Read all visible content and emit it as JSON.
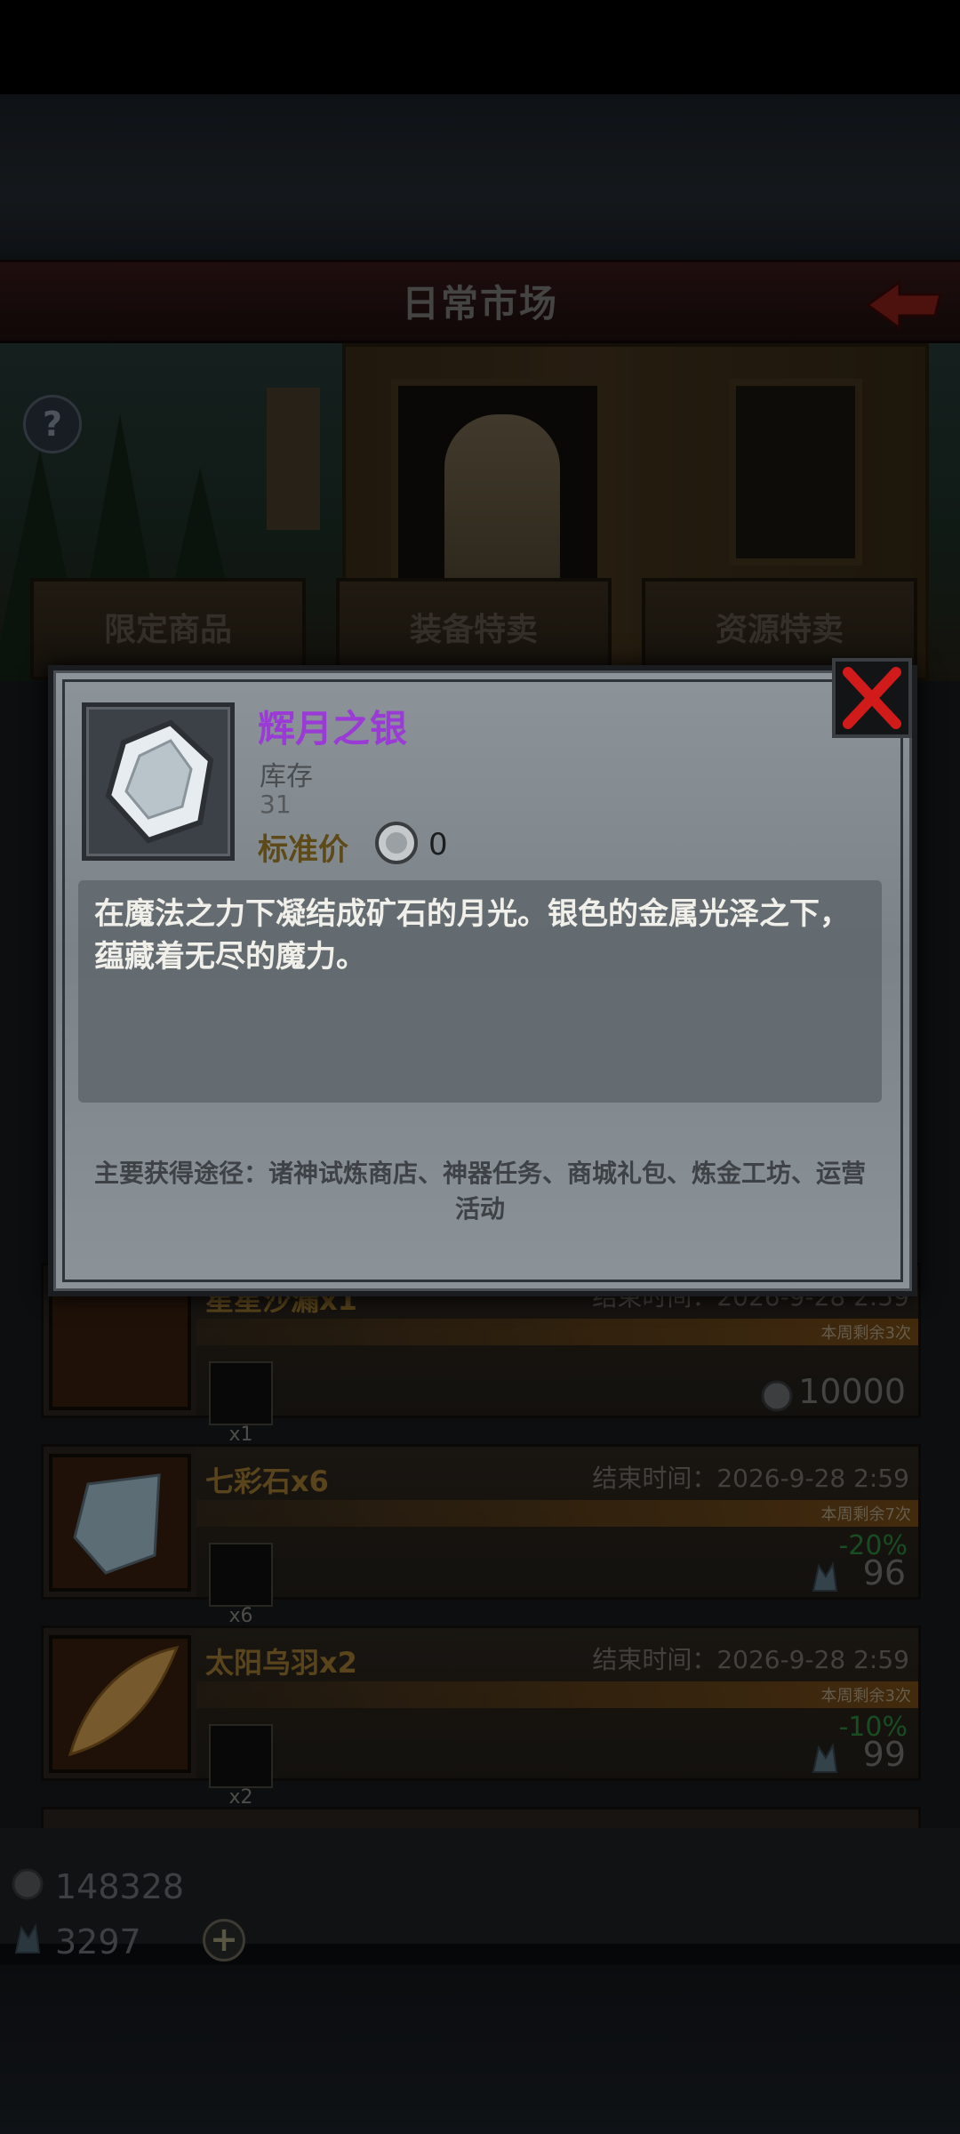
{
  "header": {
    "title": "日常市场"
  },
  "tabs": [
    {
      "label": "限定商品"
    },
    {
      "label": "装备特卖"
    },
    {
      "label": "资源特卖"
    }
  ],
  "items": [
    {
      "name": "星星沙漏x1",
      "end_time": "结束时间：2026-9-28 2:59",
      "weekly": "本周剩余3次",
      "qty": "x1",
      "discount": "",
      "price": "10000",
      "currency_icon": "silver-coin-icon"
    },
    {
      "name": "七彩石x6",
      "end_time": "结束时间：2026-9-28 2:59",
      "weekly": "本周剩余7次",
      "qty": "x6",
      "discount": "-20%",
      "price": "96",
      "currency_icon": "crystal-icon"
    },
    {
      "name": "太阳乌羽x2",
      "end_time": "结束时间：2026-9-28 2:59",
      "weekly": "本周剩余3次",
      "qty": "x2",
      "discount": "-10%",
      "price": "99",
      "currency_icon": "crystal-icon"
    }
  ],
  "resources": {
    "silver": "148328",
    "crystal": "3297"
  },
  "modal": {
    "item_name": "辉月之银",
    "stock_label": "库存",
    "stock_value": "31",
    "standard_price_label": "标准价",
    "standard_price_value": "0",
    "description": "在魔法之力下凝结成矿石的月光。银色的金属光泽之下，蕴藏着无尽的魔力。",
    "sources": "主要获得途径：诸神试炼商店、神器任务、商城礼包、炼金工坊、运营活动"
  },
  "colors": {
    "item_name": "#9a3bd6",
    "title_bar": "#2a1414",
    "discount": "#2d8a3d",
    "close_x": "#d11a1a"
  }
}
